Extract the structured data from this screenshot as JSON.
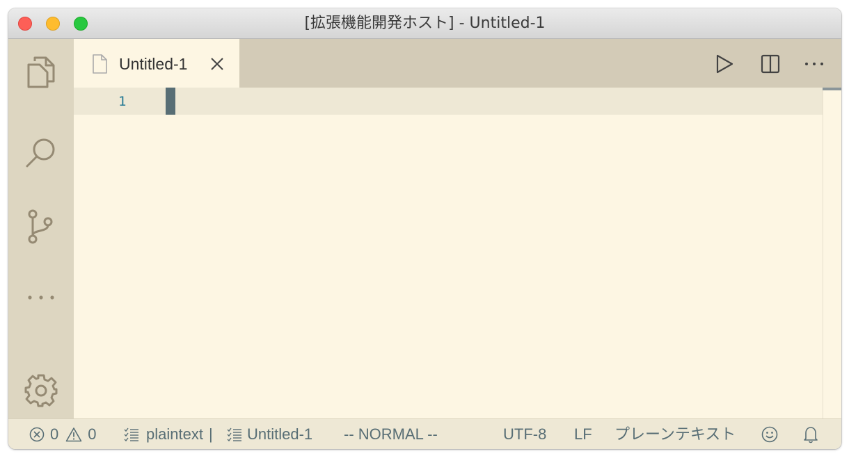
{
  "window": {
    "title": "[拡張機能開発ホスト] - Untitled-1"
  },
  "activity_bar": {
    "items": [
      {
        "icon": "explorer-icon"
      },
      {
        "icon": "search-icon"
      },
      {
        "icon": "source-control-icon"
      },
      {
        "icon": "more-icon"
      },
      {
        "icon": "settings-gear-icon"
      }
    ]
  },
  "tabs": [
    {
      "label": "Untitled-1",
      "icon": "file-icon",
      "active": true
    }
  ],
  "editor_actions": [
    {
      "icon": "run-icon"
    },
    {
      "icon": "split-editor-icon"
    },
    {
      "icon": "more-actions-icon"
    }
  ],
  "editor": {
    "line_numbers": [
      "1"
    ],
    "content": ""
  },
  "status_bar": {
    "errors": "0",
    "warnings": "0",
    "language_id": "plaintext",
    "separator": "|",
    "file_name": "Untitled-1",
    "vim_mode": "-- NORMAL --",
    "encoding": "UTF-8",
    "eol": "LF",
    "language": "プレーンテキスト"
  },
  "colors": {
    "editor_bg": "#fdf6e3",
    "activity_bar_bg": "#ddd6c1",
    "tab_bar_bg": "#d3cbb7",
    "current_line_bg": "#eee8d5",
    "status_bar_bg": "#eee8d5",
    "line_number": "#237893",
    "cursor": "#586e75"
  }
}
